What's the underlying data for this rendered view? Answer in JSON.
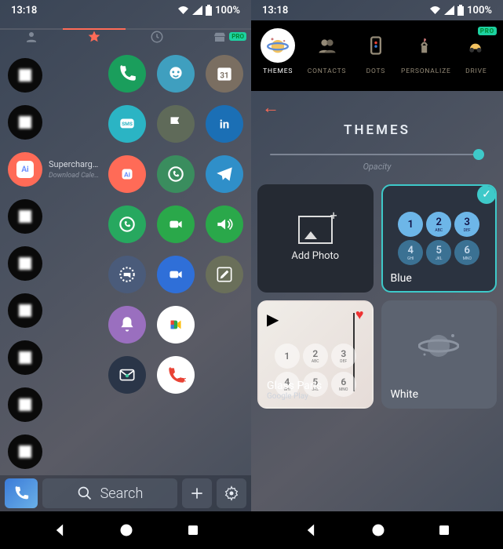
{
  "status": {
    "time": "13:18",
    "battery": "100%"
  },
  "tabs": [
    "contacts",
    "favorites",
    "recents",
    "business"
  ],
  "active_tab": 1,
  "pro_label": "PRO",
  "promo": {
    "title": "Supercharg…",
    "sub": "Download Cale…"
  },
  "apps": [
    [
      {
        "name": "phone",
        "bg": "#1a9e5c"
      },
      {
        "name": "waze",
        "bg": "#3f9fbf"
      },
      {
        "name": "calendar-31",
        "bg": "#7a6e61"
      }
    ],
    [
      {
        "name": "sms",
        "bg": "#2bb4c4"
      },
      {
        "name": "maps-flag",
        "bg": "#5f6a59"
      },
      {
        "name": "linkedin",
        "bg": "#1b6fb5"
      }
    ],
    [
      {
        "name": "ai",
        "bg": "#ff6b57"
      },
      {
        "name": "whatsapp-alt",
        "bg": "#3a8d5e"
      },
      {
        "name": "telegram",
        "bg": "#2f8fc9"
      }
    ],
    [
      {
        "name": "whatsapp",
        "bg": "#27a85f"
      },
      {
        "name": "duo-video",
        "bg": "#2aa84a"
      },
      {
        "name": "volume",
        "bg": "#2aa84a"
      }
    ],
    [
      {
        "name": "signal",
        "bg": "#4a5b7a"
      },
      {
        "name": "video",
        "bg": "#2f6fd8"
      },
      {
        "name": "compose",
        "bg": "#6a6f5a"
      }
    ],
    [
      {
        "name": "bell",
        "bg": "#9a6fbf"
      },
      {
        "name": "meet",
        "bg": "#ffffff"
      },
      null
    ],
    [
      {
        "name": "mail",
        "bg": "#2a3548"
      },
      {
        "name": "rec",
        "bg": "#ffffff"
      },
      null
    ]
  ],
  "search_label": "Search",
  "settings": {
    "categories": [
      {
        "key": "themes",
        "label": "THEMES"
      },
      {
        "key": "contacts",
        "label": "CONTACTS"
      },
      {
        "key": "dots",
        "label": "DOTS"
      },
      {
        "key": "personalize",
        "label": "PERSONALIZE"
      },
      {
        "key": "drive",
        "label": "DRIVE"
      }
    ],
    "active_category": 0,
    "title": "THEMES",
    "opacity_label": "Opacity",
    "opacity_value": 100,
    "themes": [
      {
        "key": "add",
        "label": "Add Photo"
      },
      {
        "key": "blue",
        "label": "Blue",
        "selected": true
      },
      {
        "key": "glass",
        "label": "Glass Paris",
        "sub": "Google Play"
      },
      {
        "key": "white",
        "label": "White"
      }
    ],
    "keypad_top": [
      {
        "n": "1",
        "l": ""
      },
      {
        "n": "2",
        "l": "ABC"
      },
      {
        "n": "3",
        "l": "DEF"
      }
    ],
    "keypad_bot": [
      {
        "n": "4",
        "l": "GHI"
      },
      {
        "n": "5",
        "l": "JKL"
      },
      {
        "n": "6",
        "l": "MNO"
      }
    ]
  }
}
